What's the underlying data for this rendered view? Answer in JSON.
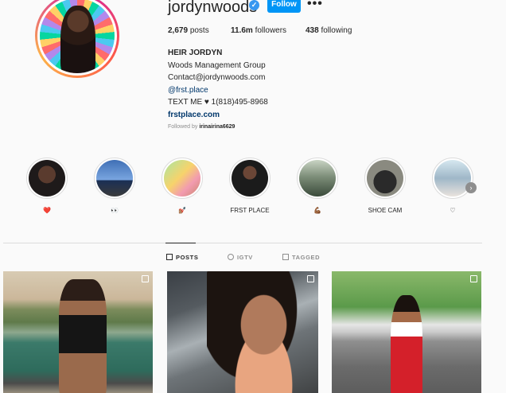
{
  "profile": {
    "username": "jordynwoods",
    "verified_glyph": "✓",
    "follow_label": "Follow",
    "more_glyph": "•••",
    "stats": {
      "posts_count": "2,679",
      "posts_label": "posts",
      "followers_count": "11.6m",
      "followers_label": "followers",
      "following_count": "438",
      "following_label": "following"
    },
    "bio": {
      "name": "HEIR JORDYN",
      "line1": "Woods Management Group",
      "line2": "Contact@jordynwoods.com",
      "mention": "@frst.place",
      "line3": "TEXT ME ♥ 1(818)495-8968",
      "website": "frstplace.com"
    },
    "followed_by_prefix": "Followed by",
    "followed_by_user": "irinairina6629"
  },
  "highlights": [
    {
      "label": "❤️",
      "bg": "radial-gradient(circle at 50% 40%, #5a3b2e 0 30%, #1e1a1a 31% 100%)"
    },
    {
      "label": "👀",
      "bg": "linear-gradient(180deg, #3f6fb5 0%, #7aa6e0 55%, #1a2f55 56%, #3b3b3b 100%)"
    },
    {
      "label": "💅🏽",
      "bg": "linear-gradient(135deg, #a8e6a3 0%, #f7d36b 45%, #f29bb0 70%, #c9866a 100%)"
    },
    {
      "label": "FRST PLACE",
      "bg": "radial-gradient(circle at 50% 35%, #6b4636 0 22%, #1b1b1b 23% 100%)"
    },
    {
      "label": "💪🏾",
      "bg": "linear-gradient(180deg, #c9d4c4 0%, #7e8f7a 45%, #3a4a3a 100%)"
    },
    {
      "label": "SHOE CAM",
      "bg": "radial-gradient(circle at 50% 60%, #2a2a2a 0 40%, #8a8a80 41% 100%)"
    },
    {
      "label": "♡",
      "bg": "linear-gradient(180deg, #d6e8f0 0%, #9fb7c8 50%, #e9e3dd 100%)"
    }
  ],
  "next_arrow_glyph": "›",
  "tabs": [
    {
      "label": "POSTS",
      "icon": "grid-icon",
      "active": true
    },
    {
      "label": "IGTV",
      "icon": "igtv-icon",
      "active": false
    },
    {
      "label": "TAGGED",
      "icon": "tagged-icon",
      "active": false
    }
  ],
  "colors": {
    "follow_button": "#0095f6",
    "verified_badge": "#3897f0",
    "link": "#00376b",
    "muted_text": "#8e8e8e"
  }
}
